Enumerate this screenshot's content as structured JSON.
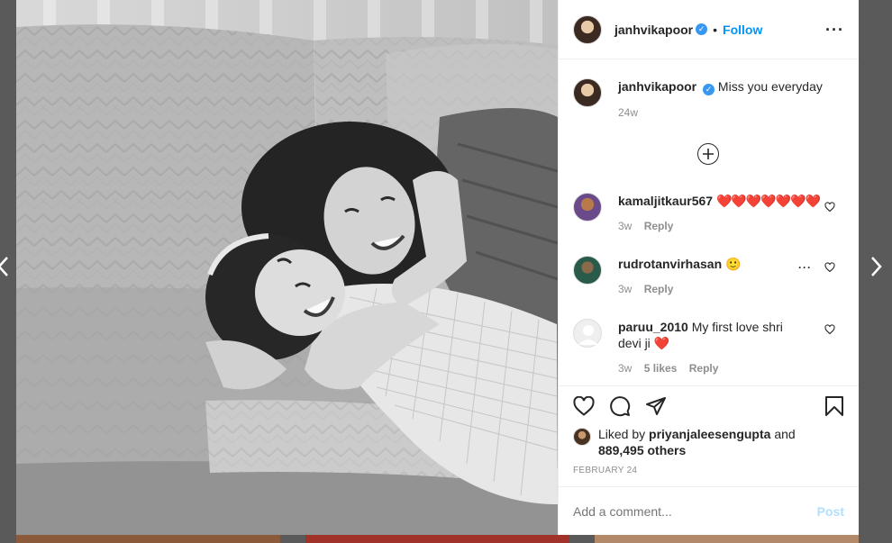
{
  "post": {
    "username": "janhvikapoor",
    "follow_label": "Follow",
    "separator": "•",
    "caption_text": "Miss you everyday",
    "caption_time": "24w"
  },
  "comments": [
    {
      "username": "kamaljitkaur567",
      "text": "❤️❤️❤️❤️❤️❤️❤️",
      "time": "3w",
      "likes": "",
      "reply": "Reply"
    },
    {
      "username": "rudrotanvirhasan",
      "text": "🙂",
      "time": "3w",
      "likes": "",
      "reply": "Reply"
    },
    {
      "username": "paruu_2010",
      "text": "My first love shri devi ji ❤️",
      "time": "3w",
      "likes": "5 likes",
      "reply": "Reply"
    }
  ],
  "likes": {
    "prefix": "Liked by",
    "user": "priyanjaleesengupta",
    "conj": "and",
    "others": "889,495 others"
  },
  "date": "FEBRUARY 24",
  "add_comment": {
    "placeholder": "Add a comment...",
    "post_label": "Post"
  },
  "colors": {
    "accent": "#0095f6",
    "verified": "#3897f0",
    "post_disabled": "#b2dffc",
    "meta": "#8e8e8e"
  },
  "icons": [
    "verified-badge-icon",
    "more-options-icon",
    "add-circle-icon",
    "heart-icon",
    "comment-icon",
    "share-icon",
    "bookmark-icon",
    "chevron-left-icon",
    "chevron-right-icon"
  ]
}
